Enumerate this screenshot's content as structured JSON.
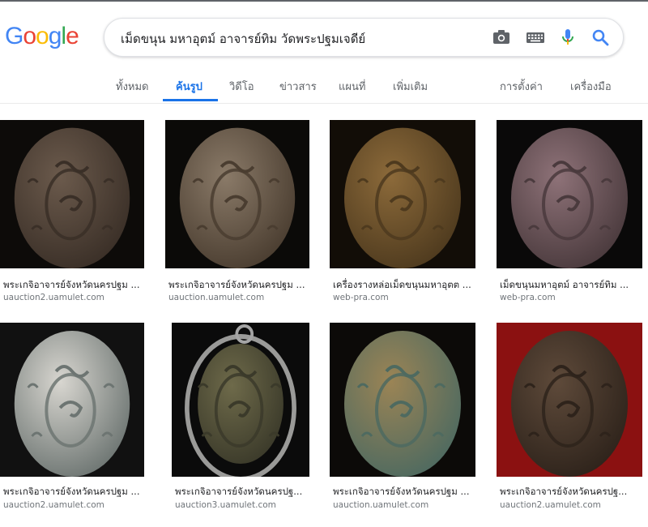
{
  "logo": {
    "letters": [
      {
        "ch": "G",
        "color": "#4285F4"
      },
      {
        "ch": "o",
        "color": "#EA4335"
      },
      {
        "ch": "o",
        "color": "#FBBC05"
      },
      {
        "ch": "g",
        "color": "#4285F4"
      },
      {
        "ch": "l",
        "color": "#34A853"
      },
      {
        "ch": "e",
        "color": "#EA4335"
      }
    ]
  },
  "search": {
    "query": "เม็ดขนุน มหาอุตม์ อาจารย์ทิม วัดพระปฐมเจดีย์",
    "icons": [
      "camera-icon",
      "keyboard-icon",
      "mic-icon",
      "search-icon"
    ]
  },
  "tabs": {
    "all": "ทั้งหมด",
    "images": "ค้นรูป",
    "videos": "วิดีโอ",
    "news": "ข่าวสาร",
    "maps": "แผนที่",
    "more": "เพิ่มเติม",
    "settings": "การตั้งค่า",
    "tools": "เครื่องมือ"
  },
  "results": [
    {
      "title": "พระเกจิอาจารย์จังหวัดนครปฐม ...",
      "domain": "uauction2.uamulet.com",
      "bg": "#0d0b09",
      "amulet": "#6b5a4c",
      "shade": "#3a2f27"
    },
    {
      "title": "พระเกจิอาจารย์จังหวัดนครปฐม ...",
      "domain": "uauction.uamulet.com",
      "bg": "#0b0a08",
      "amulet": "#8a7a68",
      "shade": "#4a3d30"
    },
    {
      "title": "เครื่องรางหล่อเม็ดขนุนมหาอุตต ...",
      "domain": "web-pra.com",
      "bg": "#120d07",
      "amulet": "#8c6a3a",
      "shade": "#4e3a1e"
    },
    {
      "title": "เม็ดขนุนมหาอุตม์ อาจารย์ทิม ...",
      "domain": "web-pra.com",
      "bg": "#0a0909",
      "amulet": "#8e7278",
      "shade": "#4a3a3d"
    },
    {
      "title": "พระเกจิอาจารย์จังหวัดนครปฐม ...",
      "domain": "uauction2.uamulet.com",
      "bg": "#111111",
      "amulet": "#d8d6d0",
      "shade": "#6d7572"
    },
    {
      "title": "พระเกจิอาจารย์จังหวัดนครปฐ...",
      "domain": "uauction3.uamulet.com",
      "bg": "#0b0b0b",
      "amulet": "#6e6a4a",
      "shade": "#3b3a2a"
    },
    {
      "title": "พระเกจิอาจารย์จังหวัดนครปฐม ...",
      "domain": "uauction.uamulet.com",
      "bg": "#0c0a08",
      "amulet": "#9b8455",
      "shade": "#4e6a60"
    },
    {
      "title": "พระเกจิอาจารย์จังหวัดนครปฐ...",
      "domain": "uauction2.uamulet.com",
      "bg": "#8b1111",
      "amulet": "#5e4a3a",
      "shade": "#2e231b"
    }
  ]
}
